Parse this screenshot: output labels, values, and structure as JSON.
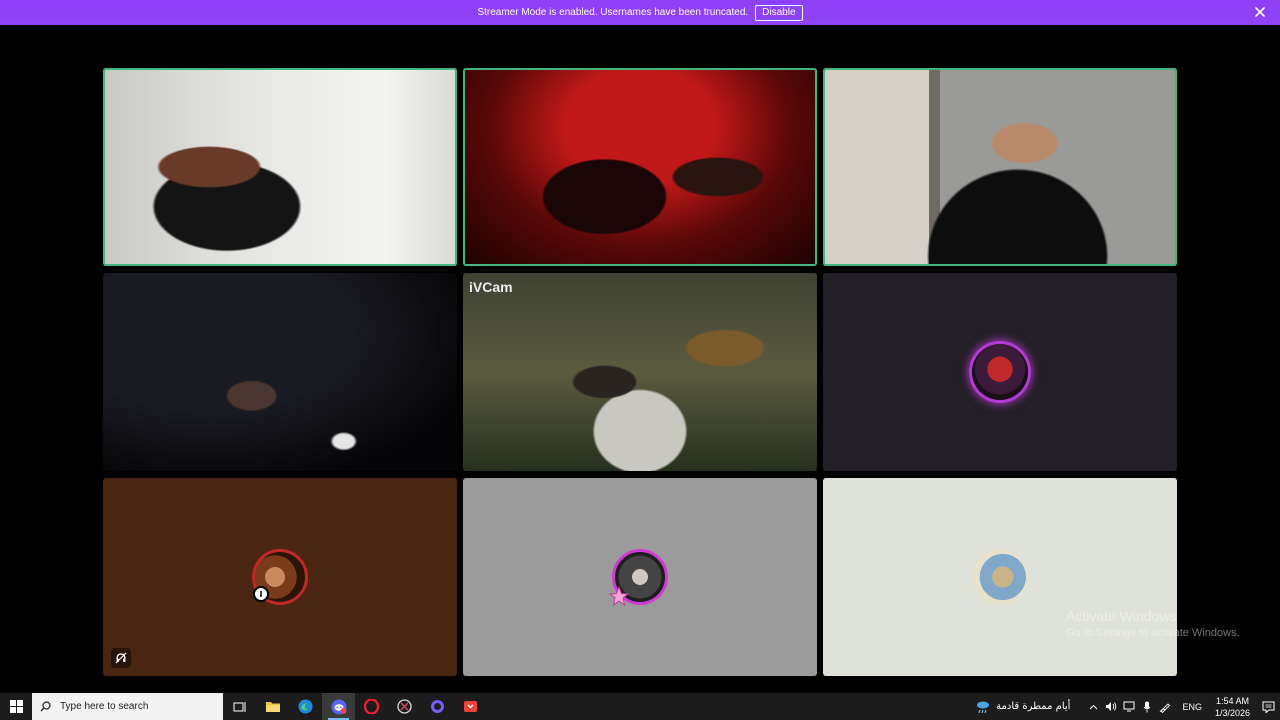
{
  "banner": {
    "message": "Streamer Mode is enabled. Usernames have been truncated.",
    "disable_label": "Disable"
  },
  "tiles": [
    {
      "type": "video",
      "speaking": true
    },
    {
      "type": "video",
      "speaking": true
    },
    {
      "type": "video",
      "speaking": true
    },
    {
      "type": "video",
      "speaking": false
    },
    {
      "type": "video",
      "speaking": false,
      "label": "iVCam"
    },
    {
      "type": "avatar",
      "background": "#221f26"
    },
    {
      "type": "avatar",
      "background": "#4a2512",
      "muted": true
    },
    {
      "type": "avatar",
      "background": "#9b9b9b"
    },
    {
      "type": "avatar",
      "background": "#dfe2d8"
    }
  ],
  "colors": {
    "banner": "#8f44f7",
    "speaking_outline": "#43b581",
    "taskbar": "#1c1c1c"
  },
  "watermark": {
    "line1": "Activate Windows",
    "line2": "Go to Settings to activate Windows."
  },
  "taskbar": {
    "search_placeholder": "Type here to search",
    "pinned_icons": [
      "task-view-icon",
      "file-explorer-icon",
      "edge-icon",
      "discord-icon",
      "opera-icon",
      "snipping-tool-icon",
      "cortana-icon",
      "anydesk-icon"
    ],
    "weather_text": "أيام ممطرة قادمة",
    "language": "ENG",
    "time": "1:54 AM",
    "date": "1/3/2026"
  }
}
